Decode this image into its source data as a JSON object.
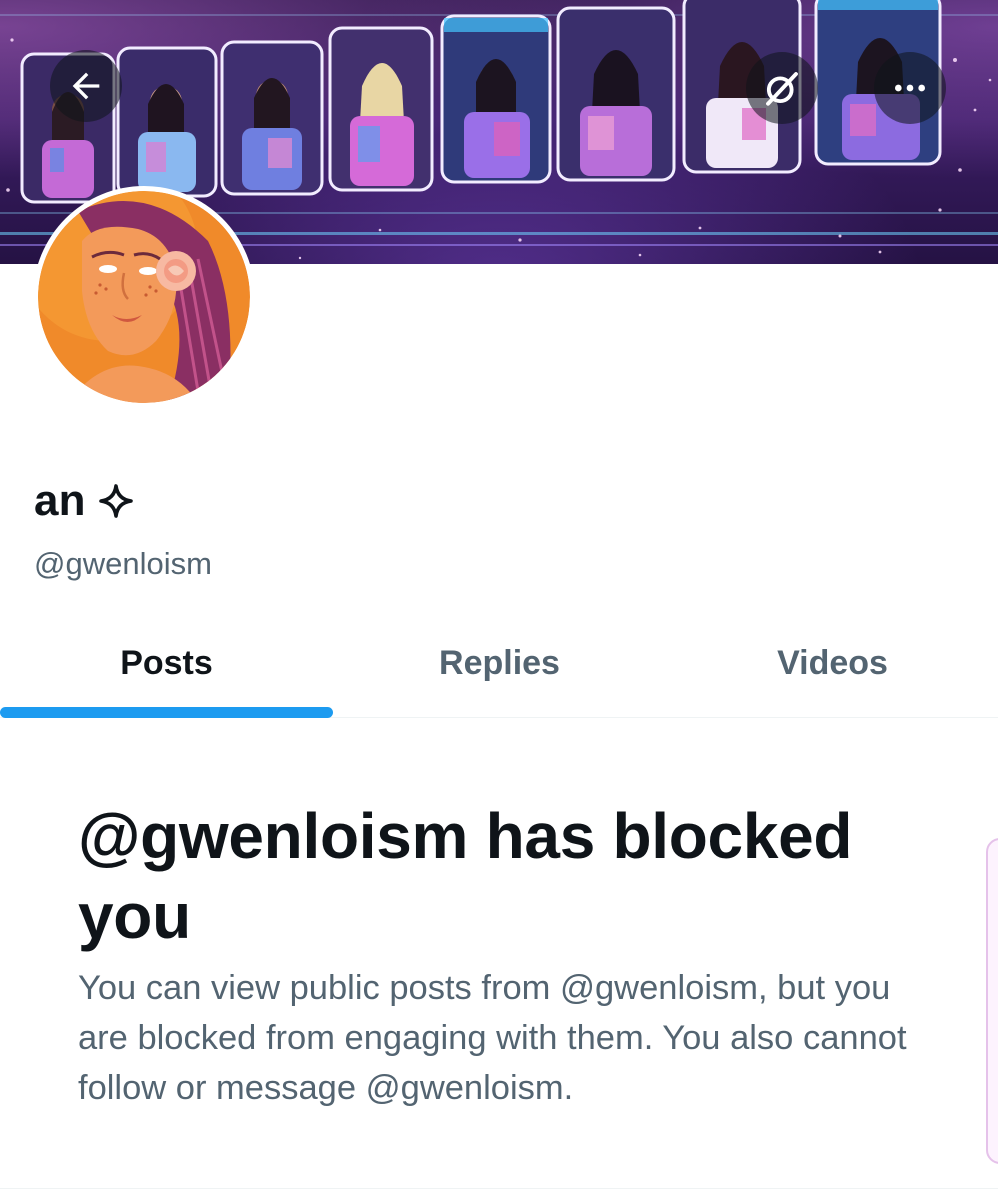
{
  "profile": {
    "display_name": "an",
    "handle": "@gwenloism"
  },
  "nav": {
    "back_icon": "arrow-left-icon",
    "grok_icon": "grok-icon",
    "more_icon": "more-icon"
  },
  "tabs": [
    {
      "label": "Posts",
      "active": true
    },
    {
      "label": "Replies",
      "active": false
    },
    {
      "label": "Videos",
      "active": false
    }
  ],
  "blocked": {
    "title": "@gwenloism has blocked you",
    "message": "You can view public posts from @gwenloism, but you are blocked from engaging with them. You also cannot follow or message @gwenloism."
  },
  "colors": {
    "accent": "#1d9bf0",
    "text_primary": "#0f1419",
    "text_secondary": "#536471"
  }
}
